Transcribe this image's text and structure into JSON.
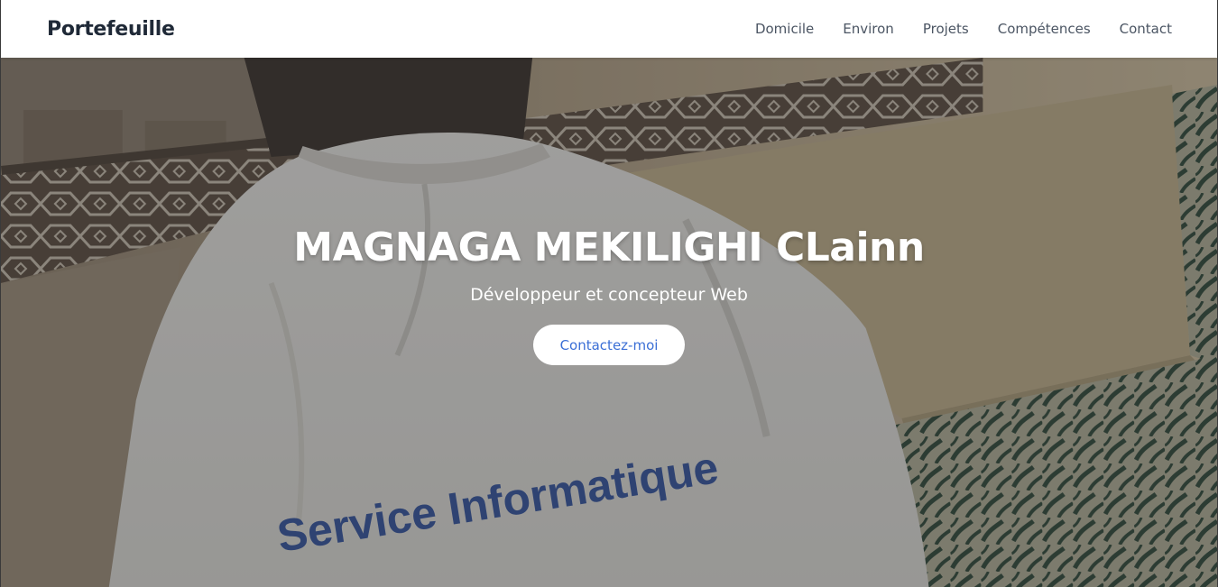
{
  "navbar": {
    "brand": "Portefeuille",
    "links": [
      "Domicile",
      "Environ",
      "Projets",
      "Compétences",
      "Contact"
    ]
  },
  "hero": {
    "title": "MAGNAGA MEKILIGHI CLainn",
    "subtitle": "Développeur et concepteur Web",
    "cta_label": "Contactez-moi",
    "photo_text": "Service Informatique"
  },
  "colors": {
    "cta_text": "#3b6fd6",
    "brand_text": "#1f2937",
    "nav_text": "#4b5563"
  }
}
